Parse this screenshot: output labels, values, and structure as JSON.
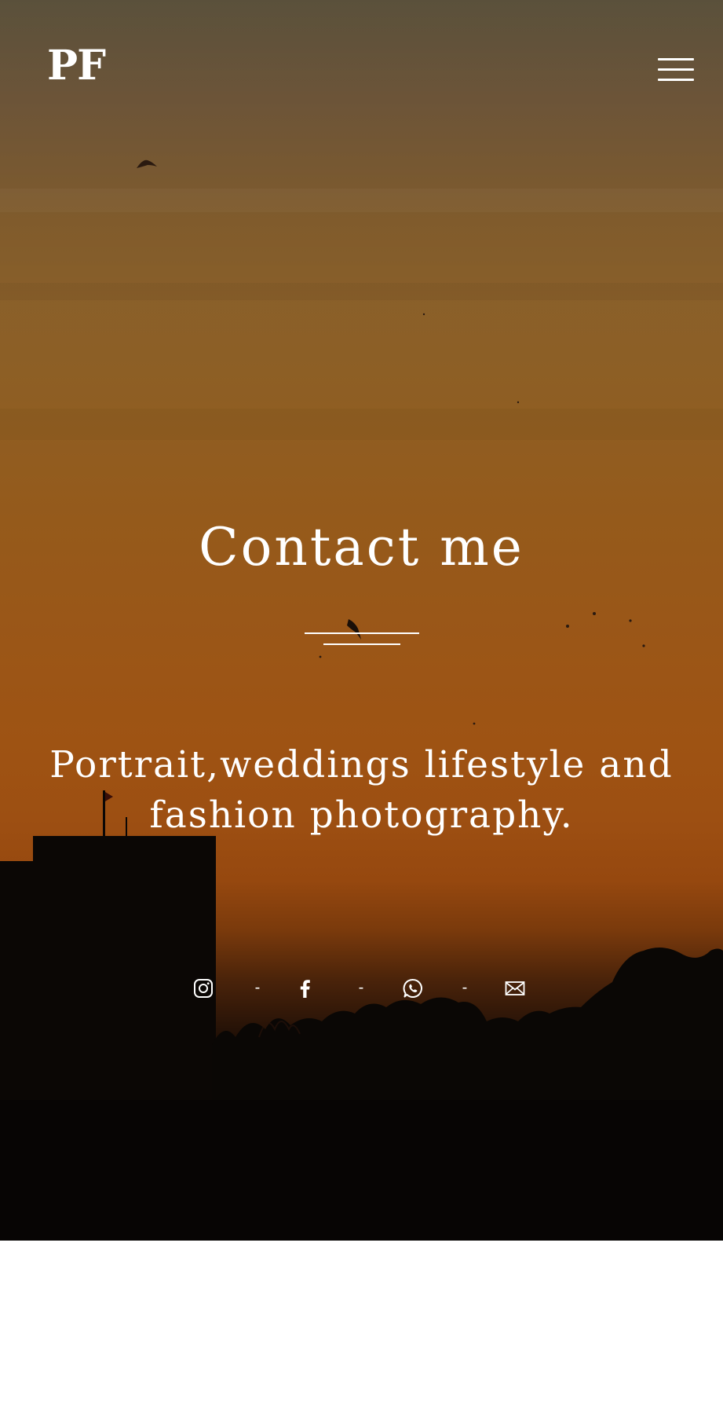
{
  "header": {
    "logo_text": "PF",
    "menu_icon": "hamburger-menu-icon"
  },
  "hero": {
    "title": "Contact me",
    "tagline_line1": "Portrait,weddings lifestyle and",
    "tagline_line2": "fashion photography."
  },
  "social": {
    "separator": "-",
    "links": [
      {
        "icon": "instagram-icon"
      },
      {
        "icon": "facebook-icon"
      },
      {
        "icon": "whatsapp-icon"
      },
      {
        "icon": "email-icon"
      }
    ]
  },
  "colors": {
    "text": "#ffffff",
    "sky_top": "#6e6248",
    "sky_mid": "#9b5617",
    "silhouette": "#080605",
    "footer_bg": "#ffffff"
  }
}
